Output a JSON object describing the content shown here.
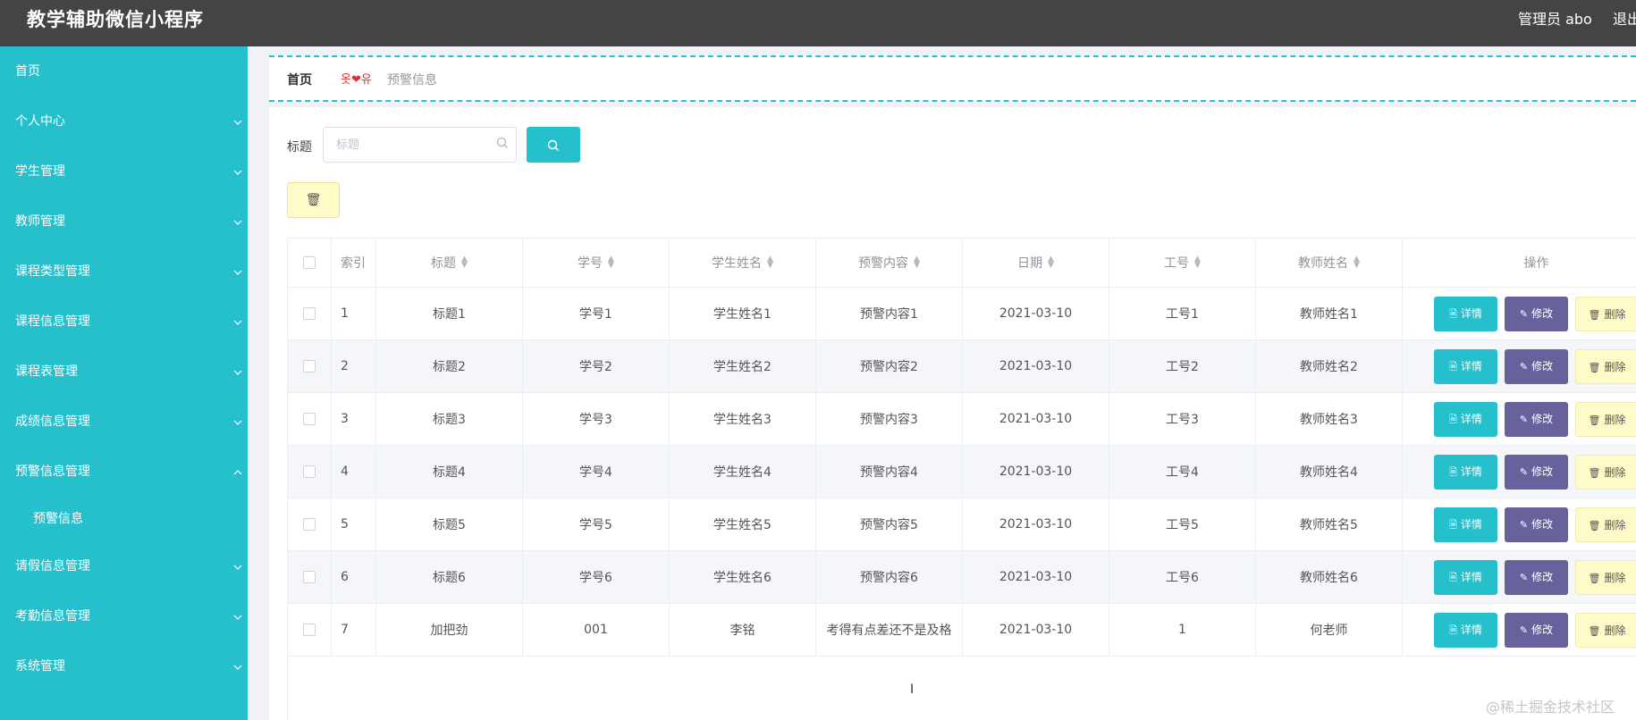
{
  "header": {
    "app_title": "教学辅助微信小程序",
    "admin_label": "管理员 abo",
    "logout_label": "退出"
  },
  "sidebar": {
    "items": [
      {
        "label": "首页",
        "has_children": false
      },
      {
        "label": "个人中心",
        "has_children": true,
        "expanded": false
      },
      {
        "label": "学生管理",
        "has_children": true,
        "expanded": false
      },
      {
        "label": "教师管理",
        "has_children": true,
        "expanded": false
      },
      {
        "label": "课程类型管理",
        "has_children": true,
        "expanded": false
      },
      {
        "label": "课程信息管理",
        "has_children": true,
        "expanded": false
      },
      {
        "label": "课程表管理",
        "has_children": true,
        "expanded": false
      },
      {
        "label": "成绩信息管理",
        "has_children": true,
        "expanded": false
      },
      {
        "label": "预警信息管理",
        "has_children": true,
        "expanded": true
      },
      {
        "label": "请假信息管理",
        "has_children": true,
        "expanded": false
      },
      {
        "label": "考勤信息管理",
        "has_children": true,
        "expanded": false
      },
      {
        "label": "系统管理",
        "has_children": true,
        "expanded": false
      }
    ],
    "submenu": {
      "label": "预警信息"
    }
  },
  "breadcrumb": {
    "home": "首页",
    "separator": "옷❤유",
    "current": "预警信息"
  },
  "search": {
    "label": "标题",
    "placeholder": "标题",
    "value": ""
  },
  "table": {
    "headers": [
      "索引",
      "标题",
      "学号",
      "学生姓名",
      "预警内容",
      "日期",
      "工号",
      "教师姓名",
      "操作"
    ],
    "actions": {
      "detail": "详情",
      "edit": "修改",
      "delete": "删除"
    },
    "rows": [
      {
        "index": "1",
        "title": "标题1",
        "student_no": "学号1",
        "student_name": "学生姓名1",
        "content": "预警内容1",
        "date": "2021-03-10",
        "staff_no": "工号1",
        "teacher_name": "教师姓名1"
      },
      {
        "index": "2",
        "title": "标题2",
        "student_no": "学号2",
        "student_name": "学生姓名2",
        "content": "预警内容2",
        "date": "2021-03-10",
        "staff_no": "工号2",
        "teacher_name": "教师姓名2"
      },
      {
        "index": "3",
        "title": "标题3",
        "student_no": "学号3",
        "student_name": "学生姓名3",
        "content": "预警内容3",
        "date": "2021-03-10",
        "staff_no": "工号3",
        "teacher_name": "教师姓名3"
      },
      {
        "index": "4",
        "title": "标题4",
        "student_no": "学号4",
        "student_name": "学生姓名4",
        "content": "预警内容4",
        "date": "2021-03-10",
        "staff_no": "工号4",
        "teacher_name": "教师姓名4"
      },
      {
        "index": "5",
        "title": "标题5",
        "student_no": "学号5",
        "student_name": "学生姓名5",
        "content": "预警内容5",
        "date": "2021-03-10",
        "staff_no": "工号5",
        "teacher_name": "教师姓名5"
      },
      {
        "index": "6",
        "title": "标题6",
        "student_no": "学号6",
        "student_name": "学生姓名6",
        "content": "预警内容6",
        "date": "2021-03-10",
        "staff_no": "工号6",
        "teacher_name": "教师姓名6"
      },
      {
        "index": "7",
        "title": "加把劲",
        "student_no": "001",
        "student_name": "李铭",
        "content": "考得有点差还不是及格",
        "date": "2021-03-10",
        "staff_no": "1",
        "teacher_name": "何老师"
      }
    ]
  },
  "watermark": "@稀土掘金技术社区",
  "colors": {
    "accent": "#26c0cc",
    "topbar": "#444446",
    "edit": "#67629b",
    "delete_bg": "#fffbc8"
  },
  "icons": {
    "search": "search-icon",
    "trash": "trash-icon",
    "detail": "document-icon",
    "edit": "pencil-icon",
    "chevron": "chevron-down-icon"
  }
}
